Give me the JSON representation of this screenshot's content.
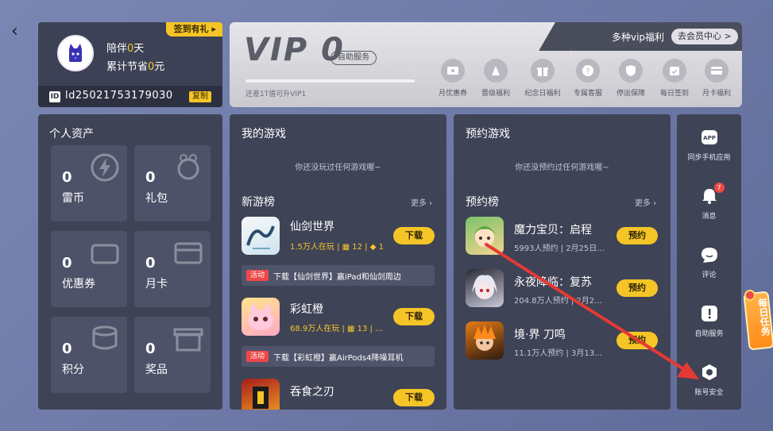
{
  "nav": {
    "back_glyph": "‹"
  },
  "user": {
    "sign_tag": "签到有礼",
    "line1_prefix": "陪伴",
    "line1_value": "0",
    "line1_suffix": "天",
    "line2_prefix": "累计节省",
    "line2_value": "0",
    "line2_suffix": "元",
    "id_badge": "ID",
    "id": "ld25021753179030",
    "copy_label": "复制",
    "avatar_icon": "cat-avatar-icon"
  },
  "vip": {
    "level_text": "VIP 0",
    "self_service_label": "自助服务",
    "progress_hint": "还差1T值可升VIP1",
    "progress_fraction": 0.0,
    "welfare_text": "多种vip福利",
    "center_button": "去会员中心 >",
    "benefits": [
      {
        "label": "月优惠券",
        "icon": "coupon-icon"
      },
      {
        "label": "晋级福利",
        "icon": "gift-icon"
      },
      {
        "label": "纪念日福利",
        "icon": "giftbox-icon"
      },
      {
        "label": "专属客服",
        "icon": "help-icon"
      },
      {
        "label": "停运保障",
        "icon": "shield-icon"
      },
      {
        "label": "每日签到",
        "icon": "calendar-icon"
      },
      {
        "label": "月卡福利",
        "icon": "card-icon"
      }
    ]
  },
  "assets": {
    "title": "个人资产",
    "tiles": [
      {
        "value": "0",
        "label": "雷币",
        "icon": "lightning-icon"
      },
      {
        "value": "0",
        "label": "礼包",
        "icon": "gift-icon"
      },
      {
        "value": "0",
        "label": "优惠券",
        "icon": "coupon-icon"
      },
      {
        "value": "0",
        "label": "月卡",
        "icon": "card-icon"
      },
      {
        "value": "0",
        "label": "积分",
        "icon": "coin-icon"
      },
      {
        "value": "0",
        "label": "奖品",
        "icon": "prize-icon"
      }
    ]
  },
  "my_games": {
    "title": "我的游戏",
    "empty": "你还没玩过任何游戏喔~",
    "new_title": "新游榜",
    "more": "更多",
    "games": [
      {
        "name": "仙剑世界",
        "players": "1.5万人在玩",
        "gift": "12",
        "coupon": "1",
        "button": "下载"
      },
      {
        "name": "彩虹橙",
        "players": "68.9万人在玩",
        "gift": "13",
        "coupon": "…",
        "button": "下载"
      },
      {
        "name": "吞食之刃",
        "players": "",
        "gift": "",
        "coupon": "",
        "button": "下载"
      }
    ],
    "activities": [
      {
        "tag": "活动",
        "text": "下载【仙剑世界】赢iPad和仙剑周边"
      },
      {
        "tag": "活动",
        "text": "下载【彩虹橙】赢AirPods4降噪耳机"
      }
    ]
  },
  "reserve": {
    "title": "预约游戏",
    "empty": "你还没预约过任何游戏喔~",
    "rank_title": "预约榜",
    "more": "更多",
    "games": [
      {
        "name": "魔力宝贝：启程",
        "count": "5993人预约",
        "date": "2月25日…",
        "button": "预约"
      },
      {
        "name": "永夜降临：复苏",
        "count": "204.8万人预约",
        "date": "2月2…",
        "button": "预约"
      },
      {
        "name": "境·界 刀鸣",
        "count": "11.1万人预约",
        "date": "3月13…",
        "button": "预约"
      }
    ]
  },
  "sidebar": {
    "items": [
      {
        "label": "同步手机应用",
        "icon": "app-icon"
      },
      {
        "label": "消息",
        "icon": "bell-icon",
        "badge": "7"
      },
      {
        "label": "评论",
        "icon": "comment-icon"
      },
      {
        "label": "自助服务",
        "icon": "exclamation-icon"
      },
      {
        "label": "账号安全",
        "icon": "gear-shield-icon"
      }
    ]
  },
  "daily_task": {
    "text": "每日任务"
  },
  "colors": {
    "accent": "#f5c527",
    "panel": "#3f4356",
    "annotation": "#e53935",
    "tag_red": "#ee4848"
  }
}
